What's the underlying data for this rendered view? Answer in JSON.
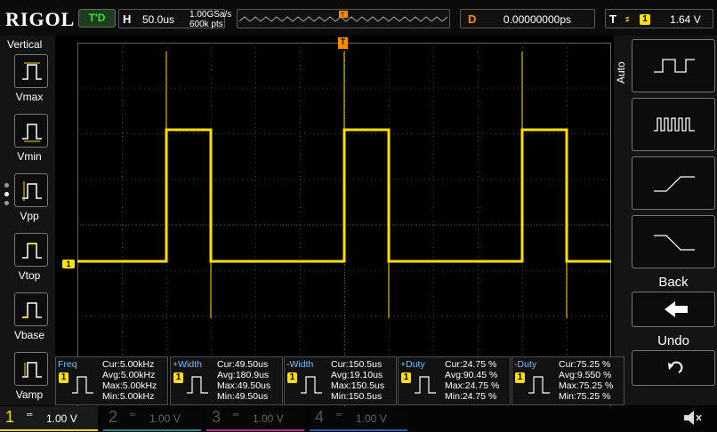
{
  "brand": "RIGOL",
  "run_status": "T'D",
  "horizontal": {
    "label": "H",
    "timebase": "50.0us",
    "sample_rate": "1.00GSa/s",
    "mem_depth": "600k pts"
  },
  "delay": {
    "label": "D",
    "value": "0.00000000ps"
  },
  "trigger": {
    "label": "T",
    "source": "1",
    "level": "1.64 V"
  },
  "left_panel": {
    "title": "Vertical",
    "buttons": [
      {
        "label": "Vmax"
      },
      {
        "label": "Vmin"
      },
      {
        "label": "Vpp"
      },
      {
        "label": "Vtop"
      },
      {
        "label": "Vbase"
      },
      {
        "label": "Vamp"
      }
    ]
  },
  "right_panel": {
    "auto_label": "Auto",
    "back_label": "Back",
    "undo_label": "Undo"
  },
  "measurements": [
    {
      "name": "Freq",
      "cur": "Cur:5.00kHz",
      "avg": "Avg:5.00kHz",
      "max": "Max:5.00kHz",
      "min": "Min:5.00kHz"
    },
    {
      "name": "+Width",
      "cur": "Cur:49.50us",
      "avg": "Avg:180.9us",
      "max": "Max:49.50us",
      "min": "Min:49.50us"
    },
    {
      "name": "-Width",
      "cur": "Cur:150.5us",
      "avg": "Avg:19.10us",
      "max": "Max:150.5us",
      "min": "Min:150.5us"
    },
    {
      "name": "+Duty",
      "cur": "Cur:24.75 %",
      "avg": "Avg:90.45 %",
      "max": "Max:24.75 %",
      "min": "Min:24.75 %"
    },
    {
      "name": "-Duty",
      "cur": "Cur:75.25 %",
      "avg": "Avg:9.550 %",
      "max": "Max:75.25 %",
      "min": "Min:75.25 %"
    }
  ],
  "channels": [
    {
      "num": "1",
      "scale": "1.00 V",
      "color": "#ffe000",
      "active": true
    },
    {
      "num": "2",
      "scale": "1.00 V",
      "color": "#2a8a8a",
      "active": false
    },
    {
      "num": "3",
      "scale": "1.00 V",
      "color": "#b3308f",
      "active": false
    },
    {
      "num": "4",
      "scale": "1.00 V",
      "color": "#2a5da8",
      "active": false
    }
  ],
  "trace": {
    "channel": "1",
    "color": "#ffe000",
    "ch1_marker": "1",
    "trig_marker": "T"
  },
  "colors": {
    "accent": "#ff8c00",
    "trace": "#ffe000",
    "run_status": "#3ee03e"
  }
}
